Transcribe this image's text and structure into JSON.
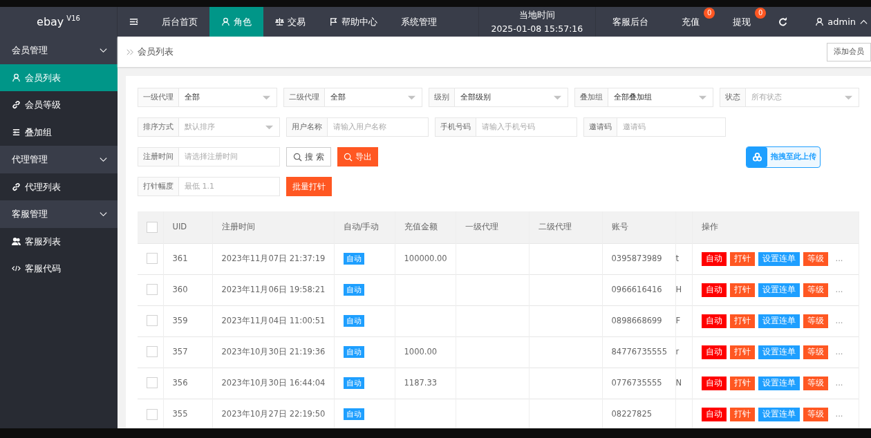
{
  "brand": {
    "name": "ebay",
    "version": "V16"
  },
  "top_nav": [
    {
      "label": "后台首页",
      "selected": false
    },
    {
      "label": "角色",
      "selected": true
    },
    {
      "label": "交易",
      "selected": false
    },
    {
      "label": "帮助中心",
      "selected": false
    },
    {
      "label": "系统管理",
      "selected": false
    }
  ],
  "clock": {
    "label": "当地时间",
    "time": "2025-01-08 15:57:16"
  },
  "top_right": [
    {
      "label": "客服后台"
    },
    {
      "label": "充值",
      "badge": "0"
    },
    {
      "label": "提现",
      "badge": "0"
    }
  ],
  "user": "admin",
  "sidebar": [
    {
      "label": "会员管理",
      "expanded": true,
      "children": [
        {
          "label": "会员列表",
          "selected": true
        },
        {
          "label": "会员等级",
          "selected": false
        },
        {
          "label": "叠加组",
          "selected": false
        }
      ]
    },
    {
      "label": "代理管理",
      "expanded": true,
      "children": [
        {
          "label": "代理列表",
          "selected": false
        }
      ]
    },
    {
      "label": "客服管理",
      "expanded": true,
      "children": [
        {
          "label": "客服列表",
          "selected": false
        },
        {
          "label": "客服代码",
          "selected": false
        }
      ]
    }
  ],
  "breadcrumb": "会员列表",
  "add_button": "添加会员",
  "filter_rows": [
    [
      {
        "kind": "select",
        "label": "一级代理",
        "value": "全部"
      },
      {
        "kind": "select",
        "label": "二级代理",
        "value": "全部"
      },
      {
        "kind": "select",
        "label": "级别",
        "value": "全部级别"
      },
      {
        "kind": "select",
        "label": "叠加组",
        "value": "全部叠加组"
      },
      {
        "kind": "select",
        "label": "状态",
        "placeholder": "所有状态"
      }
    ],
    [
      {
        "kind": "select",
        "label": "排序方式",
        "placeholder": "默认排序"
      },
      {
        "kind": "input",
        "label": "用户名称",
        "placeholder": "请输入用户名称"
      },
      {
        "kind": "input",
        "label": "手机号码",
        "placeholder": "请输入手机号码"
      },
      {
        "kind": "input",
        "label": "邀请码",
        "placeholder": "邀请码"
      }
    ],
    [
      {
        "kind": "input",
        "label": "注册时间",
        "placeholder": "请选择注册时间"
      },
      {
        "kind": "search",
        "label": "搜 索"
      },
      {
        "kind": "export",
        "label": "导出"
      },
      {
        "kind": "upload",
        "label": "拖拽至此上传"
      }
    ],
    [
      {
        "kind": "input",
        "label": "打针幅度",
        "placeholder": "最低 1.1"
      },
      {
        "kind": "batch",
        "label": "批量打针"
      }
    ]
  ],
  "table": {
    "header_checked": false,
    "columns": [
      "UID",
      "注册时间",
      "自动/手动",
      "充值金额",
      "一级代理",
      "二级代理",
      "账号",
      "操作"
    ],
    "rows": [
      {
        "checked": false,
        "uid": "361",
        "time": "2023年11月07日 21:37:19",
        "mode": "自动",
        "amount": "100000.00",
        "account": "0395873989",
        "column_9": "t",
        "actions": [
          {
            "kind": "auto",
            "label": "自动"
          },
          {
            "kind": "pin",
            "label": "打针"
          },
          {
            "kind": "chain",
            "label": "设置连单"
          },
          {
            "kind": "level",
            "label": "等级"
          },
          {
            "kind": "more",
            "label": "..."
          }
        ]
      },
      {
        "checked": false,
        "uid": "360",
        "time": "2023年11月06日 19:58:21",
        "mode": "自动",
        "amount": "",
        "account": "0966616416",
        "column_9": "H",
        "actions": [
          {
            "kind": "auto",
            "label": "自动"
          },
          {
            "kind": "pin",
            "label": "打针"
          },
          {
            "kind": "chain",
            "label": "设置连单"
          },
          {
            "kind": "level",
            "label": "等级"
          },
          {
            "kind": "more",
            "label": "..."
          }
        ]
      },
      {
        "checked": false,
        "uid": "359",
        "time": "2023年11月04日 11:00:51",
        "mode": "自动",
        "amount": "",
        "account": "0898668699",
        "column_9": "F",
        "actions": [
          {
            "kind": "auto",
            "label": "自动"
          },
          {
            "kind": "pin",
            "label": "打针"
          },
          {
            "kind": "chain",
            "label": "设置连单"
          },
          {
            "kind": "level",
            "label": "等级"
          },
          {
            "kind": "more",
            "label": "..."
          }
        ]
      },
      {
        "checked": false,
        "uid": "357",
        "time": "2023年10月30日 21:19:36",
        "mode": "自动",
        "amount": "1000.00",
        "account": "84776735555",
        "column_9": "r",
        "actions": [
          {
            "kind": "auto",
            "label": "自动"
          },
          {
            "kind": "pin",
            "label": "打针"
          },
          {
            "kind": "chain",
            "label": "设置连单"
          },
          {
            "kind": "level",
            "label": "等级"
          },
          {
            "kind": "more",
            "label": "..."
          }
        ]
      },
      {
        "checked": false,
        "uid": "356",
        "time": "2023年10月30日 16:44:04",
        "mode": "自动",
        "amount": "1187.33",
        "account": "0776735555",
        "column_9": "N",
        "actions": [
          {
            "kind": "auto",
            "label": "自动"
          },
          {
            "kind": "pin",
            "label": "打针"
          },
          {
            "kind": "chain",
            "label": "设置连单"
          },
          {
            "kind": "level",
            "label": "等级"
          },
          {
            "kind": "more",
            "label": "..."
          }
        ]
      },
      {
        "checked": false,
        "uid": "355",
        "time": "2023年10月27日 22:19:50",
        "mode": "自动",
        "amount": "",
        "account": "08227825",
        "actions": [
          {
            "kind": "auto",
            "label": "自动"
          },
          {
            "kind": "pin",
            "label": "打针"
          },
          {
            "kind": "chain",
            "label": "设置连单"
          },
          {
            "kind": "level",
            "label": "等级"
          },
          {
            "kind": "more",
            "label": "..."
          }
        ]
      }
    ]
  }
}
